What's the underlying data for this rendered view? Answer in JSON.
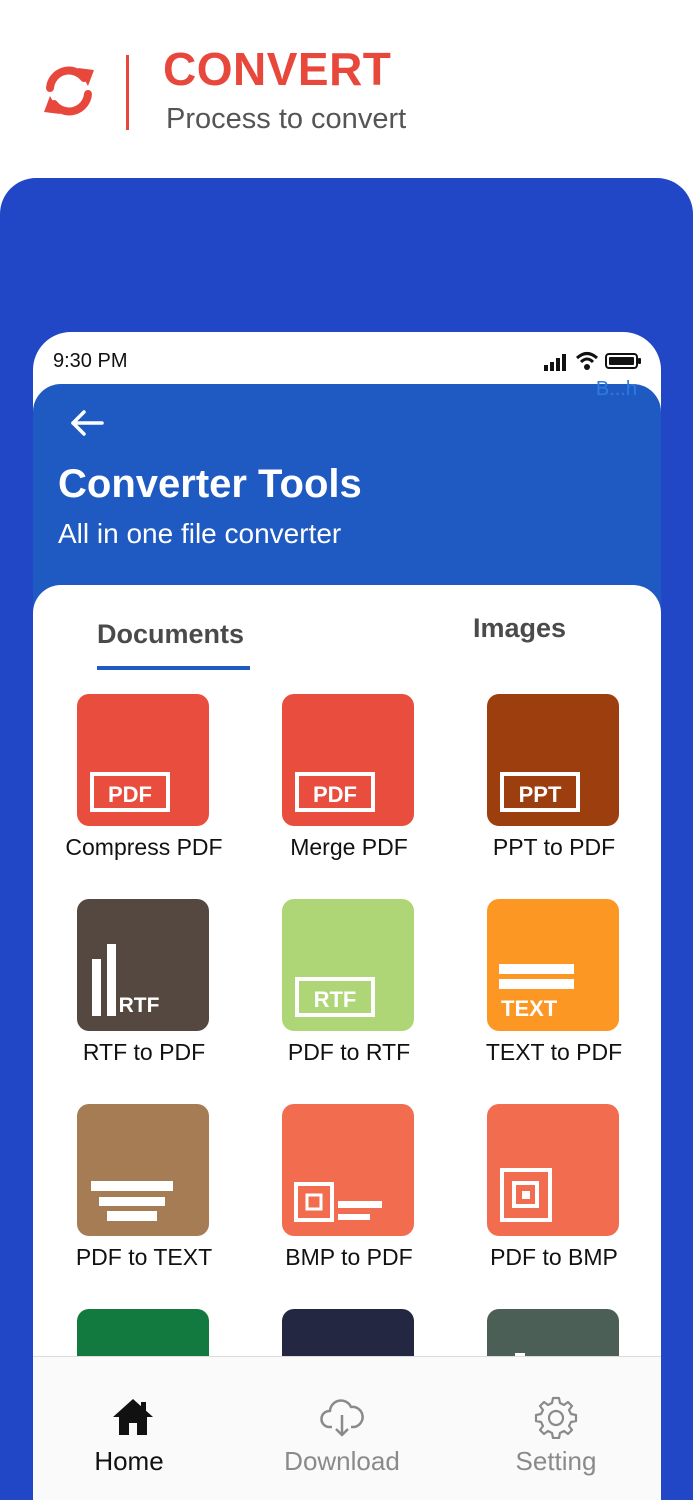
{
  "promo": {
    "title": "CONVERT",
    "subtitle": "Process to convert",
    "icon": "refresh-icon",
    "accent_color": "#e8473c"
  },
  "status_bar": {
    "time": "9:30 PM",
    "icons": [
      "signal-icon",
      "wifi-icon",
      "battery-icon"
    ]
  },
  "app": {
    "ad_text": "B...h",
    "title": "Converter Tools",
    "subtitle": "All in one file converter",
    "header_color": "#1f59c2"
  },
  "tabs": [
    {
      "label": "Documents",
      "active": true
    },
    {
      "label": "Images",
      "active": false
    }
  ],
  "tools": [
    {
      "label": "Compress PDF",
      "badge": "PDF",
      "color": "#e84d3d"
    },
    {
      "label": "Merge PDF",
      "badge": "PDF",
      "color": "#e84d3d"
    },
    {
      "label": "PPT to PDF",
      "badge": "PPT",
      "color": "#9c3e0e"
    },
    {
      "label": "RTF to PDF",
      "badge": "RTF",
      "color": "#544840"
    },
    {
      "label": "PDF to RTF",
      "badge": "RTF",
      "color": "#aed576"
    },
    {
      "label": "TEXT to PDF",
      "badge": "TEXT",
      "color": "#fd9724"
    },
    {
      "label": "PDF to TEXT",
      "badge": "",
      "color": "#a57c53"
    },
    {
      "label": "BMP to PDF",
      "badge": "",
      "color": "#f26c4f"
    },
    {
      "label": "PDF to BMP",
      "badge": "",
      "color": "#f26c4f"
    },
    {
      "label": "",
      "badge": "",
      "color": "#137a3f"
    },
    {
      "label": "",
      "badge": "",
      "color": "#232742"
    },
    {
      "label": "",
      "badge": "",
      "color": "#4c5f56"
    }
  ],
  "bottom_nav": [
    {
      "label": "Home",
      "icon": "home-icon",
      "active": true
    },
    {
      "label": "Download",
      "icon": "cloud-download-icon",
      "active": false
    },
    {
      "label": "Setting",
      "icon": "gear-icon",
      "active": false
    }
  ]
}
